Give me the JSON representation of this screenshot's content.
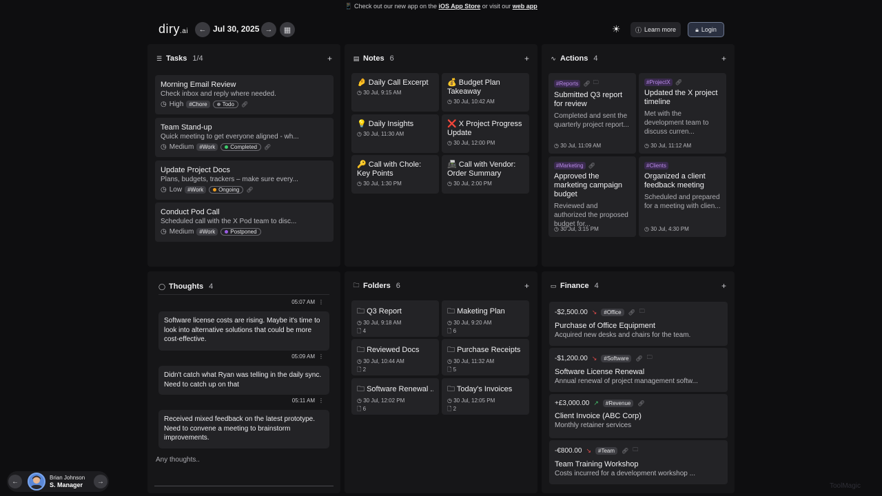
{
  "banner": {
    "prefix": "📱 Check out our new app on the ",
    "store": "iOS App Store",
    "middle": " or visit our ",
    "web": "web app"
  },
  "header": {
    "logo": "diry",
    "logo_suffix": ".ai",
    "date": "Jul 30, 2025",
    "learn_more": "Learn more",
    "login": "Login"
  },
  "tasks": {
    "title": "Tasks",
    "count": "1/4",
    "items": [
      {
        "title": "Morning Email Review",
        "desc": "Check inbox and reply where needed.",
        "priority": "High",
        "tag": "#Chore",
        "status": "Todo",
        "status_color": "#8a8a8f"
      },
      {
        "title": "Team Stand-up",
        "desc": "Quick meeting to get everyone aligned - wh...",
        "priority": "Medium",
        "tag": "#Work",
        "status": "Completed",
        "status_color": "#3ecf6e"
      },
      {
        "title": "Update Project Docs",
        "desc": "Plans, budgets, trackers – make sure every...",
        "priority": "Low",
        "tag": "#Work",
        "status": "Ongoing",
        "status_color": "#f0a020"
      },
      {
        "title": "Conduct Pod Call",
        "desc": "Scheduled call with the X Pod team to disc...",
        "priority": "Medium",
        "tag": "#Work",
        "status": "Postponed",
        "status_color": "#9b5de5"
      }
    ]
  },
  "notes": {
    "title": "Notes",
    "count": "6",
    "items": [
      {
        "emoji": "🤌",
        "title": "Daily Call Excerpt",
        "time": "30 Jul, 9:15 AM"
      },
      {
        "emoji": "💰",
        "title": "Budget Plan Takeaway",
        "time": "30 Jul, 10:42 AM"
      },
      {
        "emoji": "💡",
        "title": "Daily Insights",
        "time": "30 Jul, 11:30 AM"
      },
      {
        "emoji": "❌",
        "title": "X Project Progress Update",
        "time": "30 Jul, 12:00 PM"
      },
      {
        "emoji": "🔑",
        "title": "Call with Chole: Key Points",
        "time": "30 Jul, 1:30 PM"
      },
      {
        "emoji": "📠",
        "title": "Call with Vendor: Order Summary",
        "time": "30 Jul, 2:00 PM"
      }
    ]
  },
  "actions": {
    "title": "Actions",
    "count": "4",
    "items": [
      {
        "tag": "#Reports",
        "title": "Submitted Q3 report for review",
        "desc": "Completed and sent the quarterly project report...",
        "time": "30 Jul, 11:09 AM"
      },
      {
        "tag": "#ProjectX",
        "title": "Updated the X project timeline",
        "desc": "Met with the development team to discuss curren...",
        "time": "30 Jul, 11:12 AM"
      },
      {
        "tag": "#Marketing",
        "title": "Approved the marketing campaign budget",
        "desc": "Reviewed and authorized the proposed budget for...",
        "time": "30 Jul, 3:15 PM"
      },
      {
        "tag": "#Clients",
        "title": "Organized a client feedback meeting",
        "desc": "Scheduled and prepared for a meeting with clien...",
        "time": "30 Jul, 4:30 PM"
      }
    ]
  },
  "thoughts": {
    "title": "Thoughts",
    "count": "4",
    "placeholder": "Any thoughts..",
    "items": [
      {
        "time": "05:07 AM",
        "text": "Software license costs are rising. Maybe it's time to look into alternative solutions that could be more cost-effective."
      },
      {
        "time": "05:09 AM",
        "text": "Didn't catch what Ryan was telling in the daily sync. Need to catch up on that"
      },
      {
        "time": "05:11 AM",
        "text": "Received mixed feedback on the latest prototype. Need to convene a meeting to brainstorm improvements."
      }
    ]
  },
  "folders": {
    "title": "Folders",
    "count": "6",
    "items": [
      {
        "title": "Q3 Report",
        "time": "30 Jul, 9:18 AM",
        "files": "4"
      },
      {
        "title": "Maketing Plan",
        "time": "30 Jul, 9:20 AM",
        "files": "6"
      },
      {
        "title": "Reviewed Docs",
        "time": "30 Jul, 10:44 AM",
        "files": "2"
      },
      {
        "title": "Purchase Receipts",
        "time": "30 Jul, 11:32 AM",
        "files": "5"
      },
      {
        "title": "Software Renewal ...",
        "time": "30 Jul, 12:02 PM",
        "files": "6"
      },
      {
        "title": "Today's Invoices",
        "time": "30 Jul, 12:05 PM",
        "files": "2"
      }
    ]
  },
  "finance": {
    "title": "Finance",
    "count": "4",
    "items": [
      {
        "amount": "-$2,500.00",
        "direction": "out",
        "tag": "#Office",
        "title": "Purchase of Office Equipment",
        "desc": "Acquired new desks and chairs for the team."
      },
      {
        "amount": "-$1,200.00",
        "direction": "out",
        "tag": "#Software",
        "title": "Software License Renewal",
        "desc": "Annual renewal of project management softw..."
      },
      {
        "amount": "+£3,000.00",
        "direction": "in",
        "tag": "#Revenue",
        "title": "Client Invoice (ABC Corp)",
        "desc": "Monthly retainer services"
      },
      {
        "amount": "-€800.00",
        "direction": "out",
        "tag": "#Team",
        "title": "Team Training Workshop",
        "desc": "Costs incurred for a development workshop ..."
      }
    ]
  },
  "user": {
    "name": "Brian Johnson",
    "role": "S. Manager"
  },
  "watermark": "ToolMagic"
}
